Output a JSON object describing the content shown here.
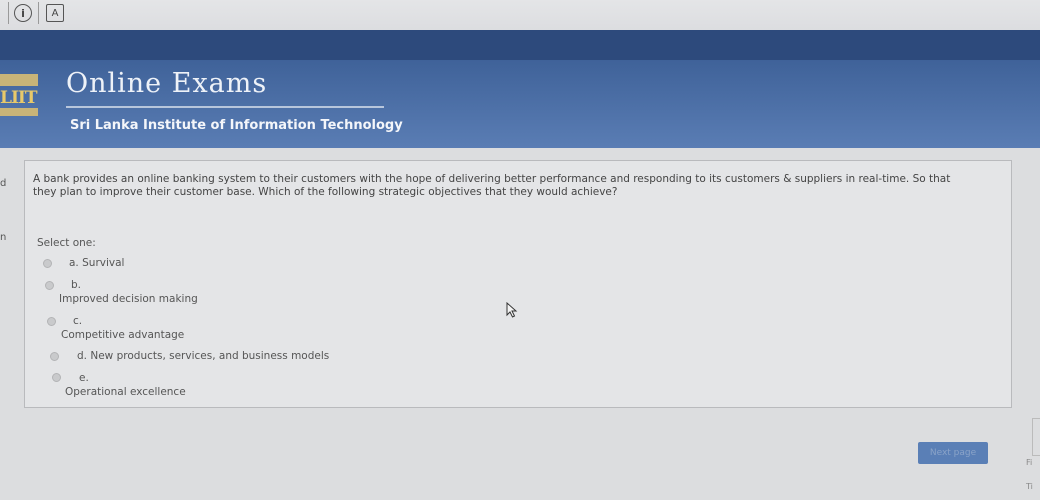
{
  "browser": {
    "info_icon": "info-circle-icon",
    "cert_glyph": "A"
  },
  "header": {
    "title": "Online Exams",
    "subtitle": "Sri Lanka Institute of Information Technology",
    "logo_text": "LIIT"
  },
  "sidebar": {
    "frag1": "d",
    "frag2": "n"
  },
  "question": {
    "text": "A bank provides an online banking system to their customers with the hope of delivering better performance and responding to its customers & suppliers in real-time. So that they plan to improve their customer base. Which of the following strategic objectives that they would achieve?",
    "prompt": "Select one:",
    "options": [
      {
        "letter": "a.",
        "text": "Survival"
      },
      {
        "letter": "b.",
        "text": "Improved decision making"
      },
      {
        "letter": "c.",
        "text": "Competitive advantage"
      },
      {
        "letter": "d.",
        "text": "New products, services, and business models"
      },
      {
        "letter": "e.",
        "text": "Operational excellence"
      }
    ]
  },
  "footer": {
    "next_label": "Next page",
    "right_frag1": "Fi",
    "right_frag2": "Ti"
  }
}
